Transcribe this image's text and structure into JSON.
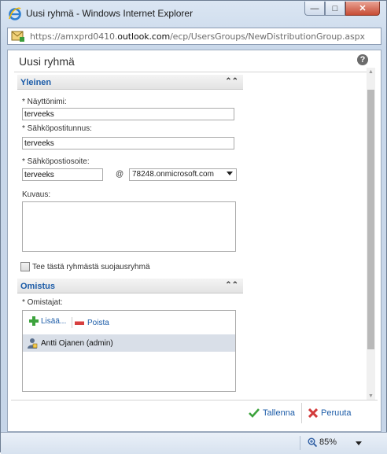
{
  "window": {
    "title": "Uusi ryhmä - Windows Internet Explorer",
    "minimize": "—",
    "maximize": "□",
    "close": "✕"
  },
  "address": {
    "prefix": "https://amxprd0410.",
    "domain": "outlook.com",
    "path": "/ecp/UsersGroups/NewDistributionGroup.aspx"
  },
  "page": {
    "title": "Uusi ryhmä",
    "help": "?"
  },
  "general": {
    "header": "Yleinen",
    "display_name_label": "* Näyttönimi:",
    "display_name_value": "terveeks",
    "alias_label": "* Sähköpostitunnus:",
    "alias_value": "terveeks",
    "email_label": "* Sähköpostiosoite:",
    "email_value": "terveeks",
    "at_sign": "@",
    "domain_value": "78248.onmicrosoft.com",
    "description_label": "Kuvaus:",
    "security_group_label": "Tee tästä ryhmästä suojausryhmä"
  },
  "ownership": {
    "header": "Omistus",
    "owners_label": "* Omistajat:",
    "add_label": "Lisää...",
    "remove_label": "Poista",
    "owners": [
      "Antti Ojanen (admin)"
    ]
  },
  "footer": {
    "save_label": "Tallenna",
    "cancel_label": "Peruuta"
  },
  "status": {
    "zoom": "85%"
  },
  "colors": {
    "link_blue": "#1c5ca8",
    "selected_row": "#d9dfe8"
  }
}
